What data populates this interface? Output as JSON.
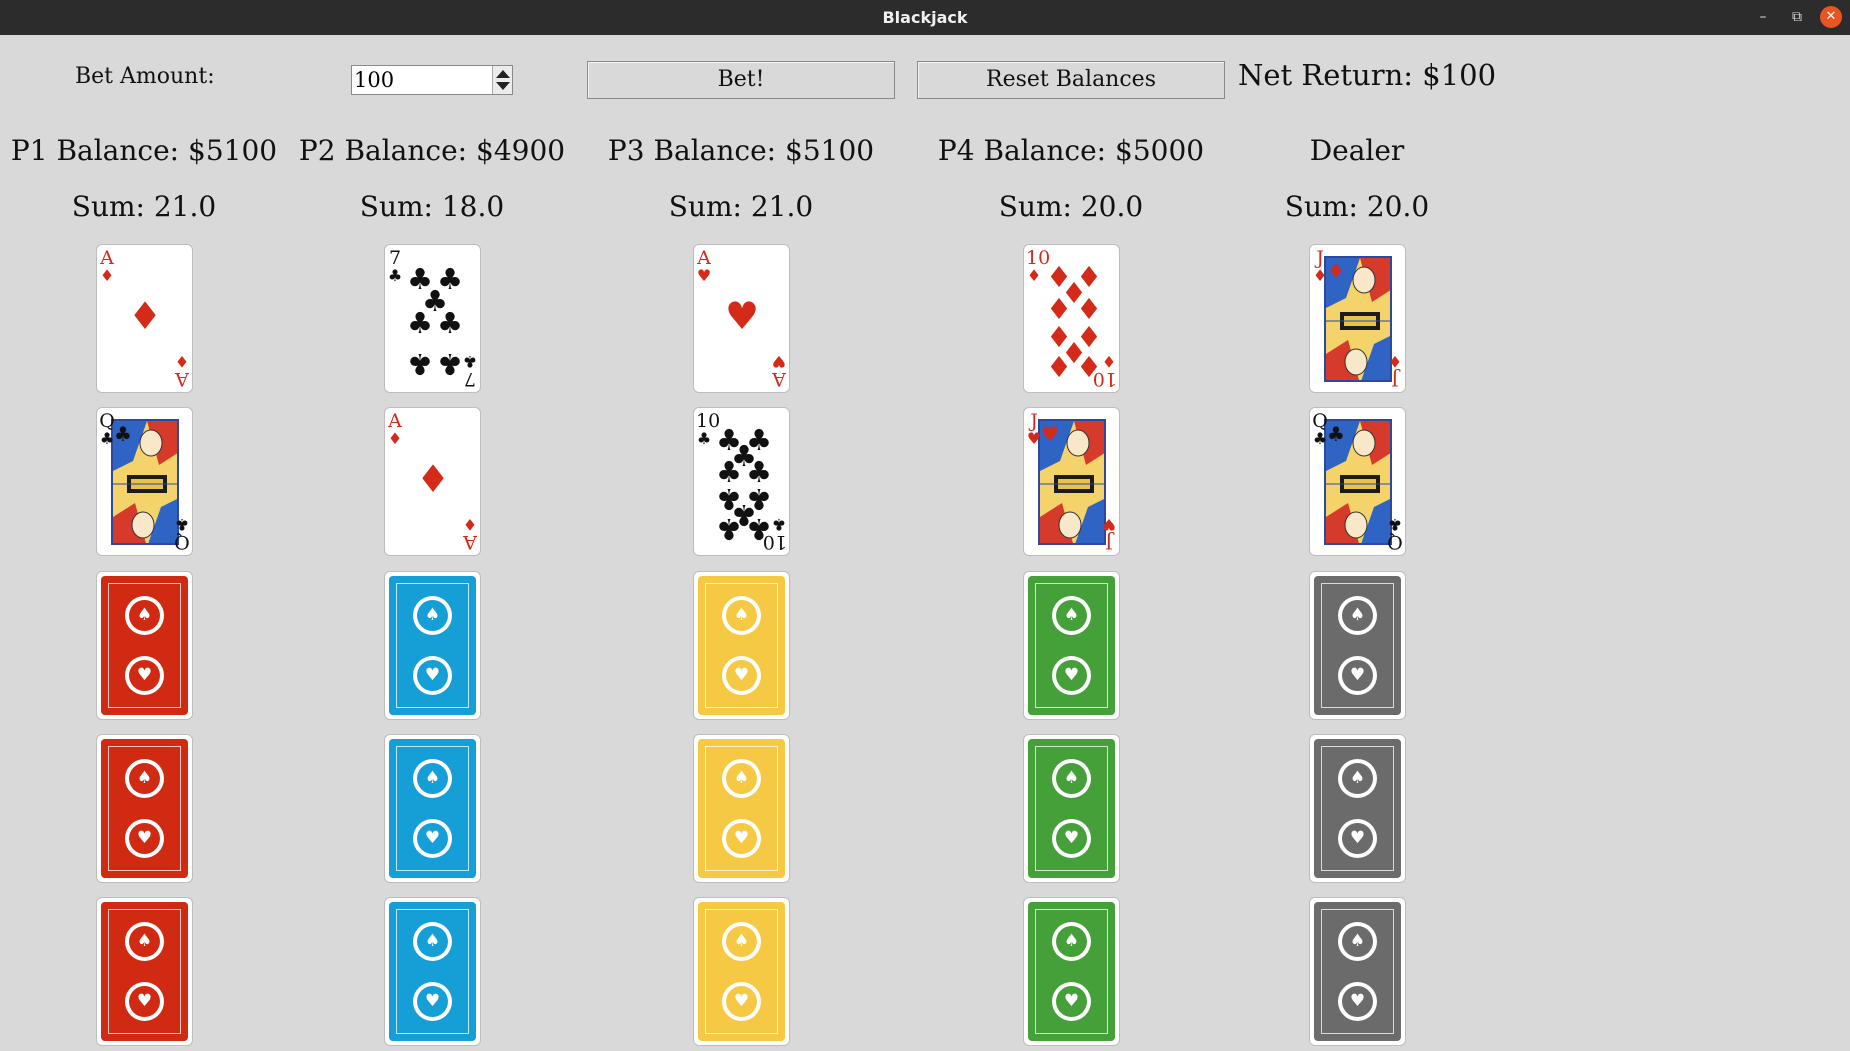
{
  "window": {
    "title": "Blackjack",
    "minimize": "–",
    "restore": "⧉",
    "close": "✕"
  },
  "controls": {
    "bet_label": "Bet Amount:",
    "bet_value": "100",
    "bet_button": "Bet!",
    "reset_button": "Reset Balances",
    "net_return": "Net Return: $100"
  },
  "columns": [
    {
      "header": "P1 Balance: $5100",
      "sum": "Sum: 21.0",
      "back_color": "#d12a12",
      "cards": [
        {
          "rank": "A",
          "suit": "♦"
        },
        {
          "rank": "Q",
          "suit": "♣"
        }
      ]
    },
    {
      "header": "P2 Balance: $4900",
      "sum": "Sum: 18.0",
      "back_color": "#159fd6",
      "cards": [
        {
          "rank": "7",
          "suit": "♣"
        },
        {
          "rank": "A",
          "suit": "♦"
        }
      ]
    },
    {
      "header": "P3 Balance: $5100",
      "sum": "Sum: 21.0",
      "back_color": "#f6c945",
      "cards": [
        {
          "rank": "A",
          "suit": "♥"
        },
        {
          "rank": "10",
          "suit": "♣"
        }
      ]
    },
    {
      "header": "P4 Balance: $5000",
      "sum": "Sum: 20.0",
      "back_color": "#45a03a",
      "cards": [
        {
          "rank": "10",
          "suit": "♦"
        },
        {
          "rank": "J",
          "suit": "♥"
        }
      ]
    },
    {
      "header": "Dealer",
      "sum": "Sum: 20.0",
      "back_color": "#6b6b6b",
      "cards": [
        {
          "rank": "J",
          "suit": "♦"
        },
        {
          "rank": "Q",
          "suit": "♣"
        }
      ]
    }
  ],
  "face_down_cards_per_column": 3,
  "icons": {
    "card_back_emblems": [
      "spade-emblem-icon",
      "heart-emblem-icon"
    ]
  }
}
